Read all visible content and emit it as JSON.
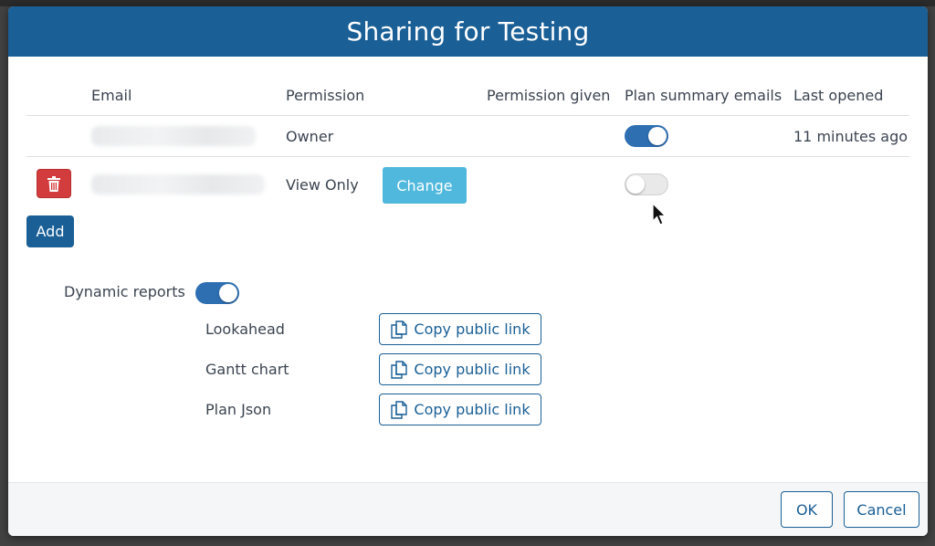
{
  "dialog": {
    "title": "Sharing for Testing"
  },
  "table": {
    "headers": {
      "email": "Email",
      "permission": "Permission",
      "permission_given": "Permission given",
      "plan_summary_emails": "Plan summary emails",
      "last_opened": "Last opened"
    },
    "rows": [
      {
        "permission": "Owner",
        "plan_summary_emails": true,
        "last_opened": "11 minutes ago"
      },
      {
        "permission": "View Only",
        "change_label": "Change",
        "plan_summary_emails": false
      }
    ]
  },
  "actions": {
    "add_label": "Add"
  },
  "dynamic_reports": {
    "label": "Dynamic reports",
    "enabled": true,
    "reports": [
      {
        "name": "Lookahead",
        "button_label": "Copy public link"
      },
      {
        "name": "Gantt chart",
        "button_label": "Copy public link"
      },
      {
        "name": "Plan Json",
        "button_label": "Copy public link"
      }
    ]
  },
  "footer": {
    "ok_label": "OK",
    "cancel_label": "Cancel"
  },
  "icons": {
    "delete": "trash-icon",
    "copy": "copy-icon",
    "cursor": "mouse-cursor-icon"
  },
  "colors": {
    "header_bg": "#1a5f96",
    "toggle_on": "#2e6fb2",
    "delete_button": "#d23c3c",
    "change_button": "#4fb8dc"
  }
}
